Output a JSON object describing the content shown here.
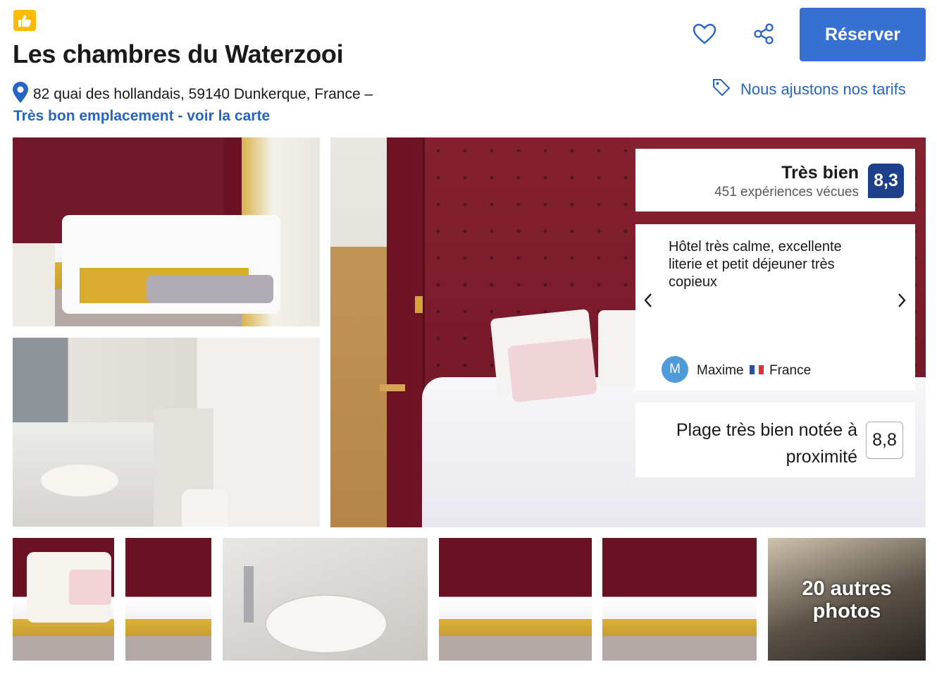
{
  "property": {
    "title": "Les chambres du Waterzooi",
    "address": "82 quai des hollandais, 59140 Dunkerque, France –",
    "location_link": "Très bon emplacement - voir la carte"
  },
  "header": {
    "reserve_label": "Réserver",
    "price_match_label": "Nous ajustons nos tarifs"
  },
  "rating": {
    "label": "Très bien",
    "reviews_count": "451 expériences vécues",
    "score": "8,3"
  },
  "review": {
    "text": "Hôtel très calme, excellente literie et petit déjeuner très copieux",
    "author_initial": "M",
    "author_name": "Maxime",
    "author_country": "France"
  },
  "beach": {
    "label_line1": "Plage très bien notée à",
    "label_line2": "proximité",
    "score": "8,8"
  },
  "gallery": {
    "more_line1": "20 autres",
    "more_line2": "photos"
  },
  "colors": {
    "brand_blue": "#3471d2",
    "link_blue": "#2665c4",
    "score_navy": "#1e3f8a",
    "badge_yellow": "#febb02"
  },
  "icons": [
    "thumbs-up-icon",
    "heart-icon",
    "share-icon",
    "map-pin-icon",
    "price-tag-icon",
    "chevron-left-icon",
    "chevron-right-icon",
    "france-flag-icon"
  ]
}
